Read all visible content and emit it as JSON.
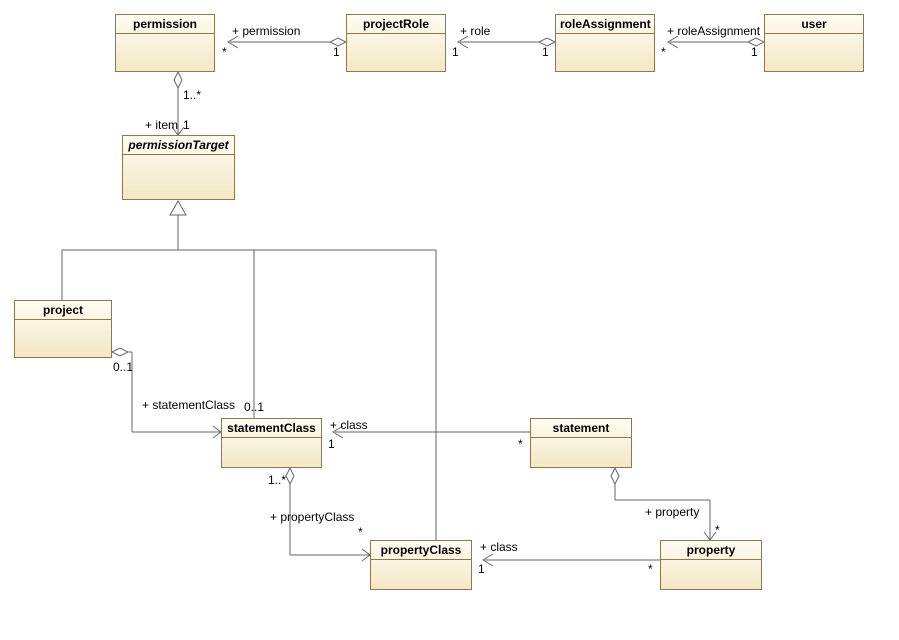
{
  "classes": {
    "permission": {
      "name": "permission"
    },
    "projectRole": {
      "name": "projectRole"
    },
    "roleAssignment": {
      "name": "roleAssignment"
    },
    "user": {
      "name": "user"
    },
    "permissionTarget": {
      "name": "permissionTarget"
    },
    "project": {
      "name": "project"
    },
    "statementClass": {
      "name": "statementClass"
    },
    "statement": {
      "name": "statement"
    },
    "propertyClass": {
      "name": "propertyClass"
    },
    "property": {
      "name": "property"
    }
  },
  "labels": {
    "permission_assoc": "+ permission",
    "role_assoc": "+ role",
    "roleAssignment_assoc": "+ roleAssignment",
    "item_assoc": "+ item",
    "statementClass_assoc": "+ statementClass",
    "class_stmt": "+ class",
    "propertyClass_assoc": "+ propertyClass",
    "class_prop": "+ class",
    "property_assoc": "+ property"
  },
  "multiplicities": {
    "star": "*",
    "one": "1",
    "one_star": "1..*",
    "zero_one": "0..1"
  }
}
